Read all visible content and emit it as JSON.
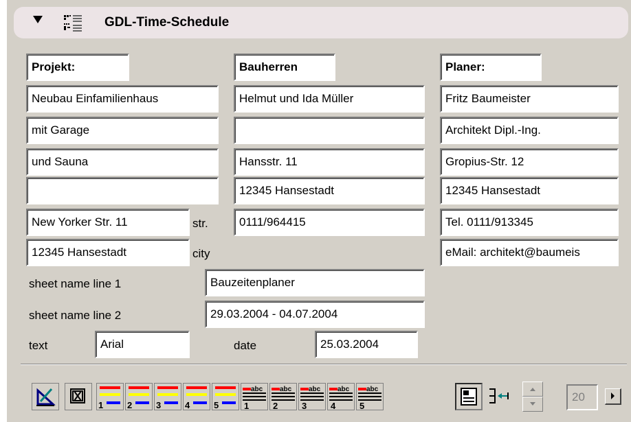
{
  "header": {
    "title": "GDL-Time-Schedule",
    "collapse_icon": "triangle-down-icon",
    "schedule_icon": "list-grid-icon"
  },
  "projekt": {
    "label": "Projekt:",
    "lines": [
      "Neubau Einfamilienhaus",
      "mit Garage",
      "und Sauna",
      "",
      "New Yorker Str. 11",
      "12345 Hansestadt"
    ],
    "str_label": "str.",
    "city_label": "city"
  },
  "bauherren": {
    "label": "Bauherren",
    "lines": [
      "Helmut und Ida Müller",
      "",
      "Hansstr. 11",
      "12345 Hansestadt",
      "0111/964415"
    ]
  },
  "planer": {
    "label": "Planer:",
    "lines": [
      "Fritz Baumeister",
      "Architekt Dipl.-Ing.",
      "Gropius-Str. 12",
      "12345 Hansestadt",
      "Tel. 0111/913345",
      "eMail: architekt@baumeis"
    ]
  },
  "sheet": {
    "line1_label": "sheet name line 1",
    "line1_value": "Bauzeitenplaner",
    "line2_label": "sheet name line 2",
    "line2_value": "29.03.2004 - 04.07.2004",
    "text_label": "text",
    "font_value": "Arial",
    "date_label": "date",
    "date_value": "25.03.2004"
  },
  "toolbar": {
    "line_style_buttons": [
      "1",
      "2",
      "3",
      "4",
      "5"
    ],
    "text_style_buttons": [
      "1",
      "2",
      "3",
      "4",
      "5"
    ],
    "abc_label": "abc",
    "page_value": "20",
    "colors": {
      "red": "#ff0000",
      "yellow": "#ffff00",
      "blue": "#0000ff"
    }
  }
}
